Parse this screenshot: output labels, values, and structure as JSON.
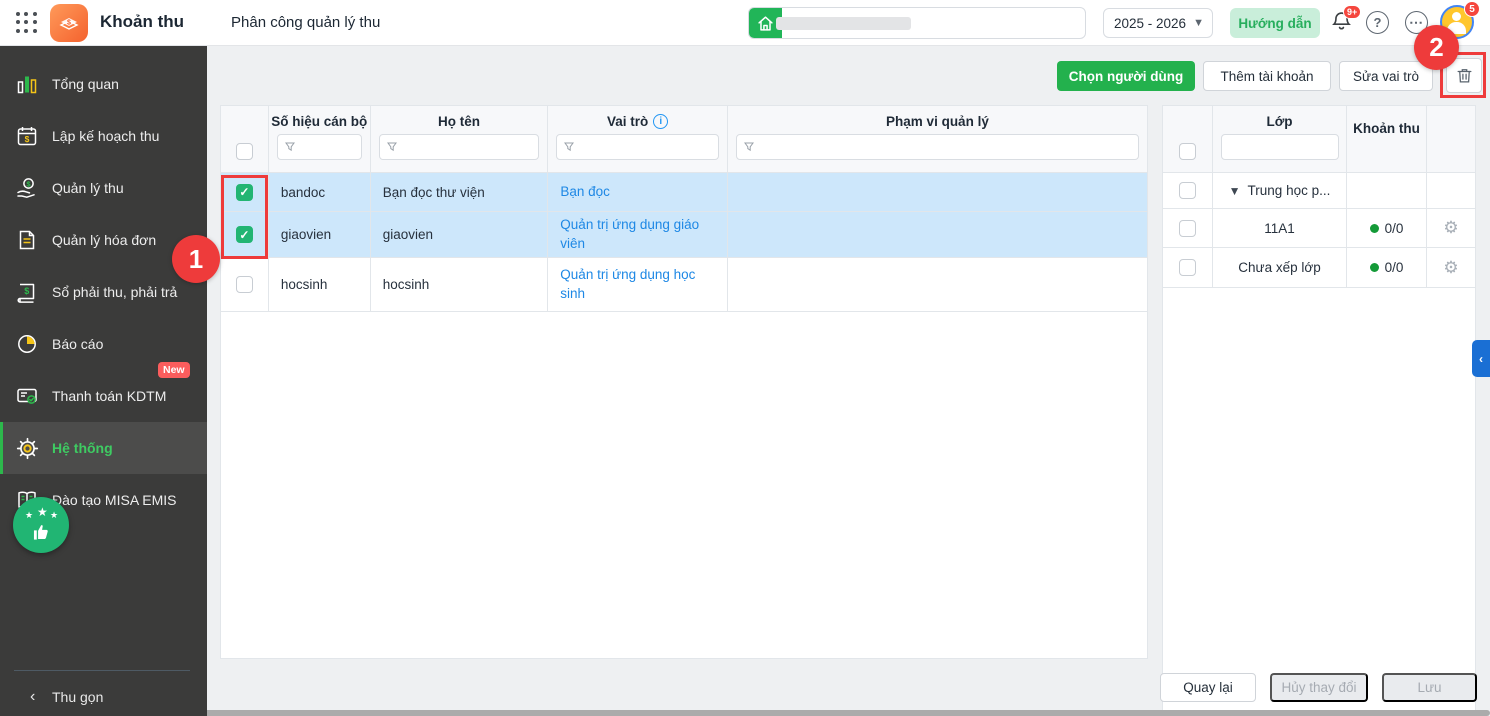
{
  "header": {
    "app_title": "Khoản thu",
    "page_title": "Phân công quản lý thu",
    "school_year": "2025 - 2026",
    "guide_button": "Hướng dẫn",
    "notification_badge": "9+",
    "avatar_badge": "5",
    "help_glyph": "?",
    "more_glyph": "⋯"
  },
  "sidebar": {
    "items": [
      {
        "label": "Tổng quan"
      },
      {
        "label": "Lập kế hoạch thu"
      },
      {
        "label": "Quản lý thu"
      },
      {
        "label": "Quản lý hóa đơn"
      },
      {
        "label": "Sổ phải thu, phải trả"
      },
      {
        "label": "Báo cáo"
      },
      {
        "label": "Thanh toán KDTM",
        "badge": "New"
      },
      {
        "label": "Hệ thống",
        "active": true
      },
      {
        "label": "Đào tạo MISA EMIS"
      }
    ],
    "collapse_label": "Thu gọn",
    "collapse_chevron": "‹"
  },
  "toolbar": {
    "select_user_button": "Chọn người dùng",
    "add_account_button": "Thêm tài khoản",
    "edit_role_button": "Sửa vai trò"
  },
  "users_table": {
    "columns": {
      "code": "Số hiệu cán bộ",
      "name": "Họ tên",
      "role": "Vai trò",
      "scope": "Phạm vi quản lý"
    },
    "info_glyph": "i",
    "rows": [
      {
        "code": "bandoc",
        "name": "Bạn đọc thư viện",
        "role": "Bạn đọc",
        "scope": "",
        "checked": true
      },
      {
        "code": "giaovien",
        "name": "giaovien",
        "role": "Quản trị ứng dụng giáo viên",
        "scope": "",
        "checked": true
      },
      {
        "code": "hocsinh",
        "name": "hocsinh",
        "role": "Quản trị ứng dụng học sinh",
        "scope": "",
        "checked": false
      }
    ]
  },
  "classes_table": {
    "columns": {
      "class": "Lớp",
      "fee": "Khoản thu"
    },
    "rows": [
      {
        "name": "Trung học p...",
        "group": true,
        "fee": ""
      },
      {
        "name": "11A1",
        "fee": "0/0"
      },
      {
        "name": "Chưa xếp lớp",
        "fee": "0/0"
      }
    ]
  },
  "footer": {
    "back_button": "Quay lại",
    "cancel_button": "Hủy thay đổi",
    "save_button": "Lưu"
  },
  "annotations": {
    "step1": "1",
    "step2": "2"
  },
  "colors": {
    "primary_green": "#23b14d",
    "checkbox_green": "#22b573",
    "link_blue": "#1e88e5",
    "selected_row_blue": "#cde7fb",
    "annotation_red": "#ee3b3b",
    "sidebar_bg": "#3b3b3a",
    "badge_red": "#f5463d",
    "panel_tab_blue": "#1a6fd4"
  }
}
